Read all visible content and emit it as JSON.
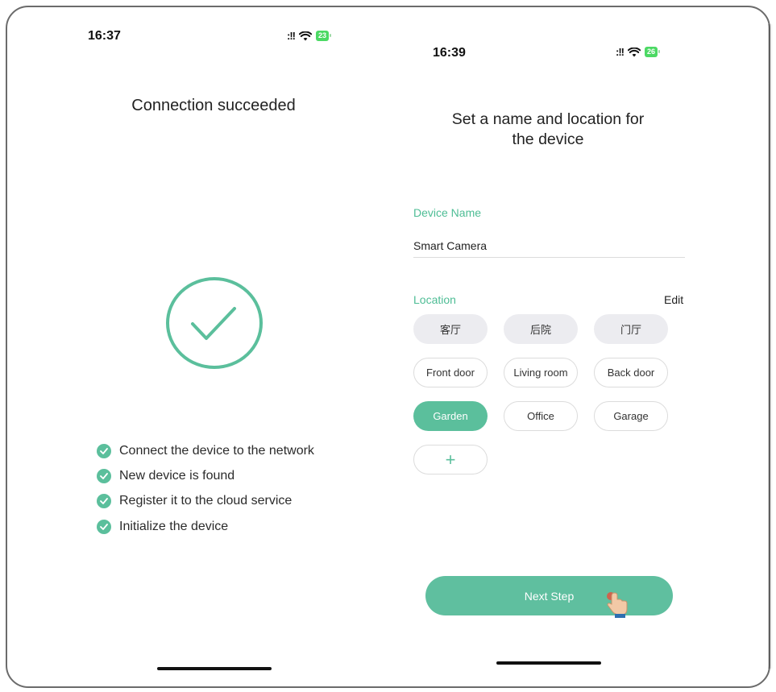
{
  "left_screen": {
    "status": {
      "time": "16:37",
      "signal": ":!!",
      "battery": "23"
    },
    "title": "Connection succeeded",
    "steps": [
      "Connect the device to the network",
      "New device is found",
      "Register it to the cloud service",
      "Initialize the device"
    ]
  },
  "right_screen": {
    "status": {
      "time": "16:39",
      "signal": ":!!",
      "battery": "26"
    },
    "title_line1": "Set a name and location for",
    "title_line2": "the device",
    "device_name": {
      "label": "Device Name",
      "value": "Smart Camera"
    },
    "location": {
      "label": "Location",
      "edit_label": "Edit",
      "chips": [
        "客厅",
        "后院",
        "门厅",
        "Front door",
        "Living room",
        "Back door",
        "Garden",
        "Office",
        "Garage"
      ],
      "selected": "Garden",
      "add_label": "+"
    },
    "next_button": "Next Step"
  },
  "colors": {
    "accent": "#5bbf9c",
    "label_green": "#4ebd95",
    "chip_grey": "#ececf0"
  },
  "icons": [
    "check-circle-icon",
    "check-icon",
    "wifi-icon",
    "battery-icon",
    "signal-icon",
    "hand-pointer-icon",
    "plus-icon"
  ]
}
